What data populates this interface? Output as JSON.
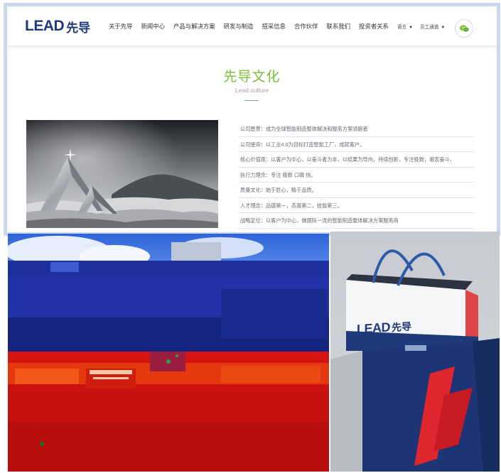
{
  "site": {
    "logo": {
      "mark": "LEAD",
      "cn": "先导"
    },
    "nav": [
      {
        "label": "关于先导"
      },
      {
        "label": "新闻中心"
      },
      {
        "label": "产品与解决方案"
      },
      {
        "label": "研发与制造"
      },
      {
        "label": "招采信息"
      },
      {
        "label": "合作伙伴"
      },
      {
        "label": "联系我们"
      },
      {
        "label": "投资者关系"
      }
    ],
    "language_label": "语言",
    "staff_label": "员工通道",
    "section_title": "先导文化",
    "section_subtitle": "Lead culture",
    "culture_items": [
      "公司愿景：成为全球智能制造整体解决和服务方案领跑者",
      "公司使命：以工业4.0为目标打造智能工厂，成就客户。",
      "核心价值观：以客户为中心，以奋斗者为本，以结果为导向，持续创新，专注极致，艰苦奋斗，",
      "执行力理念：专注 极致 口碑 快。",
      "质量文化：始于匠心，精于品质。",
      "人才理念：品德第一，态度第二，技能第三。",
      "战略定位：以客户为中心，做国际一流的智能制造整体解决方案服务商"
    ]
  },
  "bag": {
    "logo_mark": "LEAD",
    "logo_cn": "先导"
  },
  "colors": {
    "brand_blue": "#1f3a78",
    "brand_red": "#e02a2a",
    "accent_green": "#7cbd3a"
  },
  "icons": {
    "wechat": "wechat-icon",
    "caret": "caret-down-icon"
  }
}
